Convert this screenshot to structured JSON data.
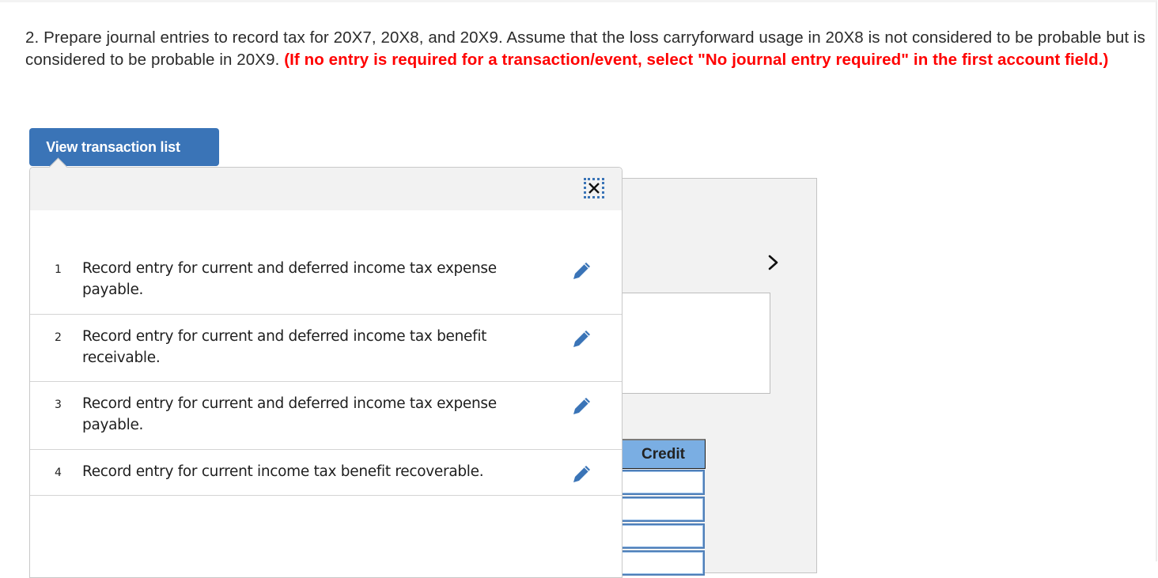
{
  "question": {
    "text": "2. Prepare journal entries to record tax for 20X7, 20X8, and 20X9. Assume that the loss carryforward usage in 20X8 is not considered to be probable but is considered to be probable in 20X9.",
    "instruction": "(If no entry is required for a transaction/event, select \"No journal entry required\" in the first account field.)"
  },
  "transaction_list": {
    "button_label": "View transaction list",
    "close_icon": "close-icon",
    "edit_icon": "pencil-icon",
    "items": [
      {
        "number": "1",
        "description": "Record entry for current and deferred income tax expense payable."
      },
      {
        "number": "2",
        "description": "Record entry for current and deferred income tax benefit receivable."
      },
      {
        "number": "3",
        "description": "Record entry for current and deferred income tax expense payable."
      },
      {
        "number": "4",
        "description": "Record entry for current income tax benefit recoverable."
      }
    ]
  },
  "worksheet": {
    "next_icon": "chevron-right-icon",
    "credit_header": "Credit",
    "credit_values": [
      "",
      "",
      "",
      ""
    ]
  },
  "colors": {
    "accent_blue": "#3a74b7",
    "instruction_red": "#ff0000",
    "header_blue": "#7aaee3"
  }
}
